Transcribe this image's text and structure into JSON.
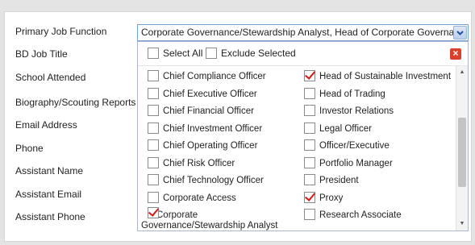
{
  "form": {
    "labels": [
      "Primary Job Function",
      "BD Job Title",
      "School Attended",
      "Biography/Scouting Reports",
      "Email Address",
      "Phone",
      "Assistant Name",
      "Assistant Email",
      "Assistant Phone"
    ]
  },
  "select": {
    "value": "Corporate Governance/Stewardship Analyst, Head of Corporate Governance/S"
  },
  "dropdown": {
    "select_all": "Select All",
    "exclude_selected": "Exclude Selected",
    "options_left": [
      {
        "label": "Chief Compliance Officer",
        "checked": false
      },
      {
        "label": "Chief Executive Officer",
        "checked": false
      },
      {
        "label": "Chief Financial Officer",
        "checked": false
      },
      {
        "label": "Chief Investment Officer",
        "checked": false
      },
      {
        "label": "Chief Operating Officer",
        "checked": false
      },
      {
        "label": "Chief Risk Officer",
        "checked": false
      },
      {
        "label": "Chief Technology Officer",
        "checked": false
      },
      {
        "label": "Corporate Access",
        "checked": false
      },
      {
        "label": "Corporate Governance/Stewardship Analyst",
        "checked": true
      }
    ],
    "options_right": [
      {
        "label": "Head of Sustainable Investment",
        "checked": true
      },
      {
        "label": "Head of Trading",
        "checked": false
      },
      {
        "label": "Investor Relations",
        "checked": false
      },
      {
        "label": "Legal Officer",
        "checked": false
      },
      {
        "label": "Officer/Executive",
        "checked": false
      },
      {
        "label": "Portfolio Manager",
        "checked": false
      },
      {
        "label": "President",
        "checked": false
      },
      {
        "label": "Proxy",
        "checked": true
      },
      {
        "label": "Research Associate",
        "checked": false
      }
    ]
  },
  "colors": {
    "check": "#d11a1a",
    "close": "#d9412b",
    "select_border": "#7aa0cf"
  },
  "icons": {
    "dropdown": "chevron-down-icon",
    "close": "close-icon",
    "scroll_up": "arrow-up-icon",
    "scroll_down": "arrow-down-icon"
  }
}
